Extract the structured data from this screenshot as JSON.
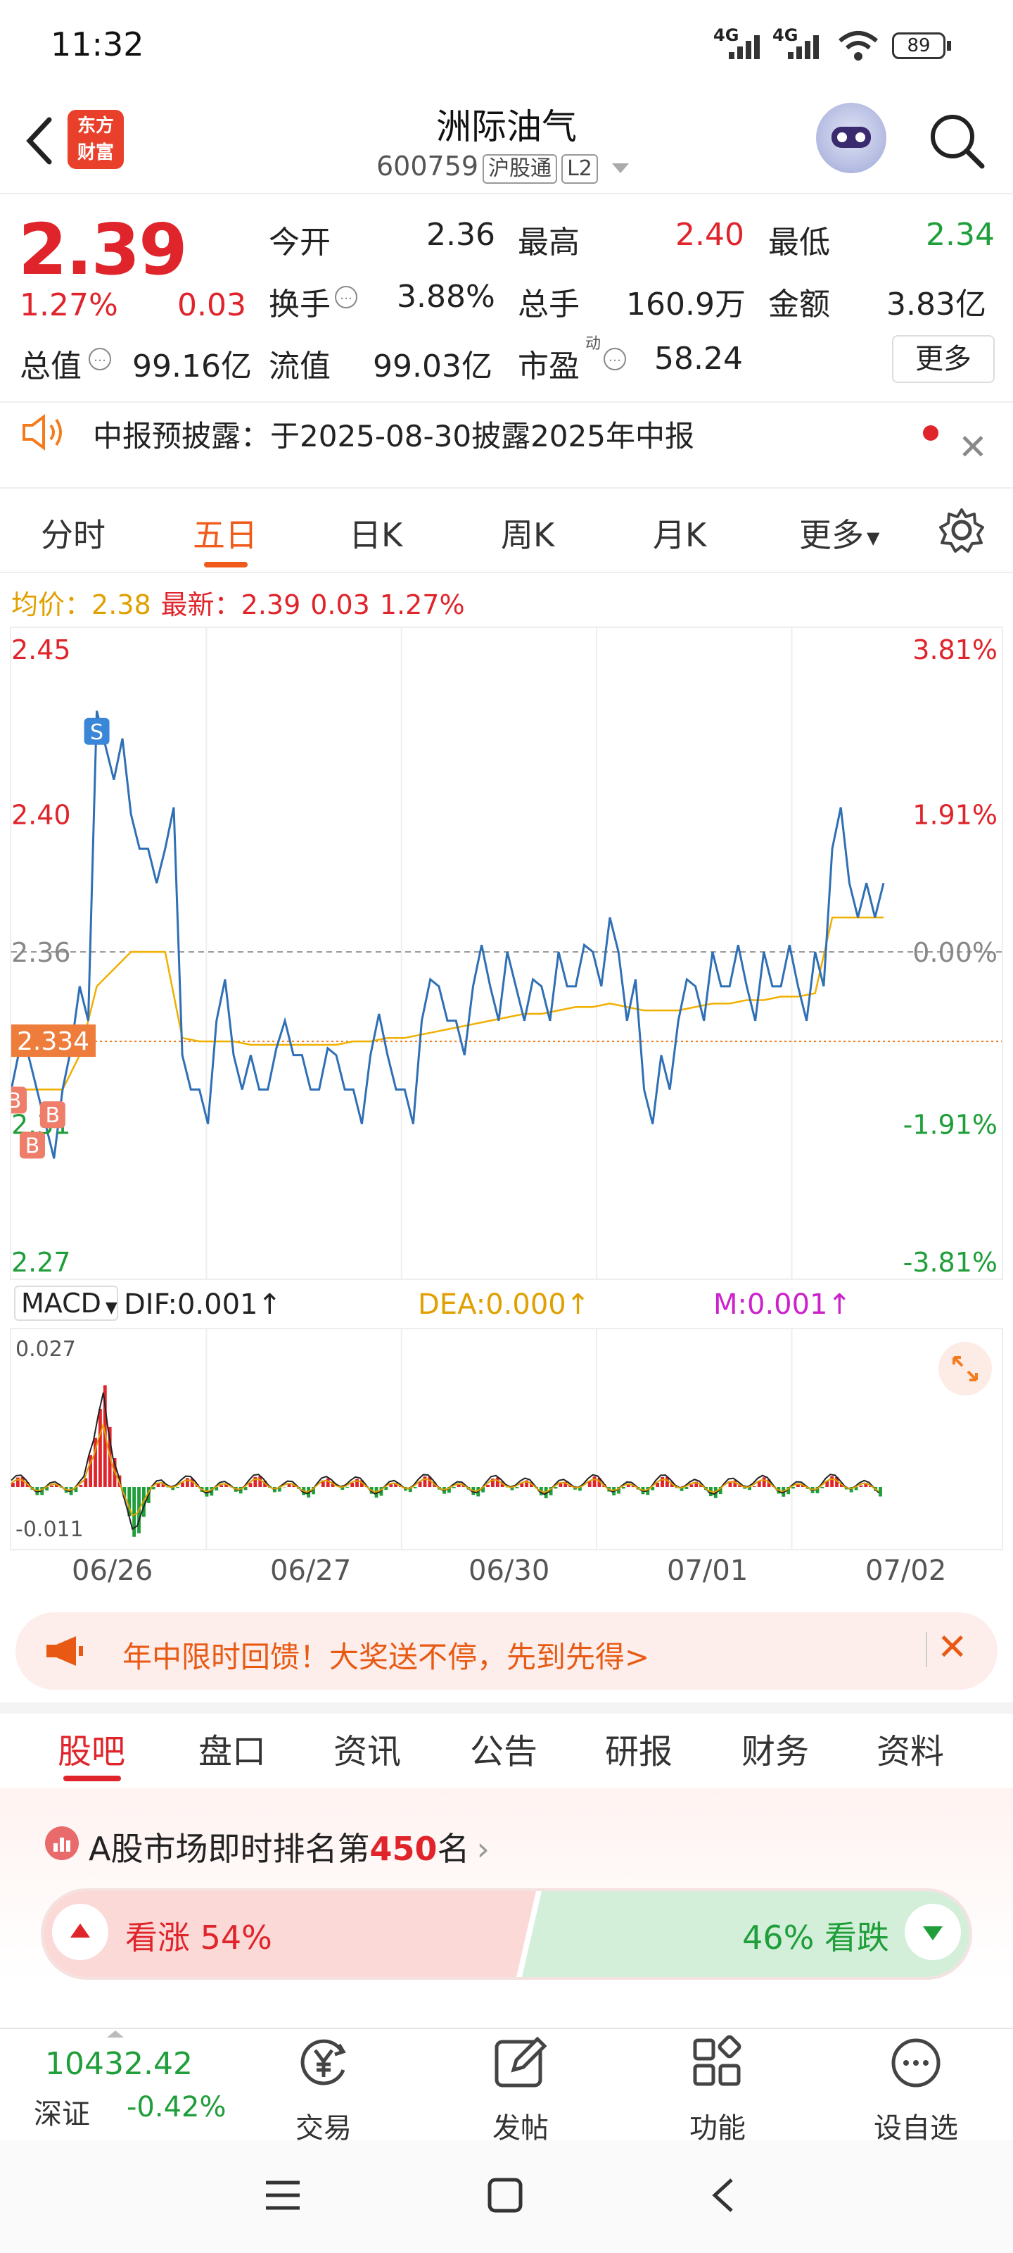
{
  "status_bar": {
    "time": "11:32",
    "net1": "4G",
    "net2": "4G",
    "battery": "89"
  },
  "header": {
    "title": "洲际油气",
    "code": "600759",
    "tag1": "沪股通",
    "tag2": "L2",
    "logo_line1": "东方",
    "logo_line2": "财富"
  },
  "quote": {
    "price": "2.39",
    "change_pct": "1.27%",
    "change": "0.03",
    "open_label": "今开",
    "open": "2.36",
    "high_label": "最高",
    "high": "2.40",
    "low_label": "最低",
    "low": "2.34",
    "turnover_label": "换手",
    "turnover": "3.88%",
    "volume_label": "总手",
    "volume": "160.9万",
    "amount_label": "金额",
    "amount": "3.83亿",
    "mktcap_label": "总值",
    "mktcap": "99.16亿",
    "float_label": "流值",
    "float": "99.03亿",
    "pe_label": "市盈",
    "pe_sup": "动",
    "pe": "58.24",
    "more": "更多"
  },
  "notice": {
    "text": "中报预披露：于2025-08-30披露2025年中报"
  },
  "chart_tabs": [
    "分时",
    "五日",
    "日K",
    "周K",
    "月K",
    "更多"
  ],
  "chart_tab_active": "五日",
  "avg_line": {
    "avg_label": "均价：",
    "avg": "2.38",
    "last_label": "最新：",
    "last": "2.39",
    "chg": "0.03",
    "pct": "1.27%"
  },
  "colors": {
    "up": "#e0242b",
    "down": "#1f9e3a",
    "accent": "#f05a1a",
    "line": "#2f6fb5",
    "avg": "#f0b000"
  },
  "chart_data": {
    "type": "line",
    "price_axis_left": [
      "2.45",
      "2.40",
      "2.36",
      "2.31",
      "2.27"
    ],
    "pct_axis_right": [
      "3.81%",
      "1.91%",
      "0.00%",
      "-1.91%",
      "-3.81%"
    ],
    "ylim": [
      2.27,
      2.45
    ],
    "prev_close": 2.36,
    "cursor_price": "2.334",
    "x_labels": [
      "06/26",
      "06/27",
      "06/30",
      "07/01",
      "07/02"
    ],
    "series": [
      {
        "values": [
          2.32,
          2.33,
          2.31,
          2.32,
          2.35,
          2.43,
          2.41,
          2.4,
          2.39,
          2.39,
          2.33,
          2.32,
          2.34,
          2.33,
          2.33,
          2.32,
          2.34,
          2.33,
          2.32,
          2.33,
          2.32,
          2.33,
          2.33,
          2.32,
          2.34,
          2.35,
          2.34,
          2.35,
          2.35,
          2.36,
          2.34,
          2.35,
          2.36,
          2.35,
          2.36,
          2.37,
          2.34,
          2.32,
          2.33,
          2.34,
          2.35,
          2.36,
          2.35,
          2.35,
          2.36,
          2.35,
          2.35,
          2.36,
          2.39,
          2.38,
          2.38,
          2.38
        ]
      },
      {
        "values": [
          2.32,
          2.32,
          2.32,
          2.32,
          2.33,
          2.35,
          2.355,
          2.36,
          2.36,
          2.36,
          2.335,
          2.334,
          2.334,
          2.334,
          2.333,
          2.333,
          2.333,
          2.333,
          2.333,
          2.333,
          2.334,
          2.334,
          2.335,
          2.335,
          2.336,
          2.337,
          2.338,
          2.339,
          2.34,
          2.341,
          2.342,
          2.342,
          2.343,
          2.344,
          2.344,
          2.345,
          2.344,
          2.343,
          2.343,
          2.343,
          2.344,
          2.345,
          2.345,
          2.346,
          2.346,
          2.347,
          2.347,
          2.348,
          2.37,
          2.37,
          2.37,
          2.37
        ]
      }
    ],
    "markers": [
      "B",
      "S",
      "B",
      "B"
    ],
    "macd": {
      "label": "MACD",
      "dif": "DIF:0.001",
      "dea": "DEA:0.000",
      "m": "M:0.001",
      "ymax": "0.027",
      "ymin": "-0.011"
    }
  },
  "promo": {
    "text": "年中限时回馈！大奖送不停，先到先得>"
  },
  "sub_tabs": [
    "股吧",
    "盘口",
    "资讯",
    "公告",
    "研报",
    "财务",
    "资料"
  ],
  "rank": {
    "prefix": "A股市场即时排名第",
    "rank": "450",
    "suffix": "名"
  },
  "vote": {
    "up_label": "看涨 54%",
    "down_label": "46% 看跌"
  },
  "bottom_nav": {
    "index_value": "10432.42",
    "index_name": "深证",
    "index_chg": "-0.42%",
    "trade": "交易",
    "post": "发帖",
    "func": "功能",
    "watch": "设自选"
  }
}
